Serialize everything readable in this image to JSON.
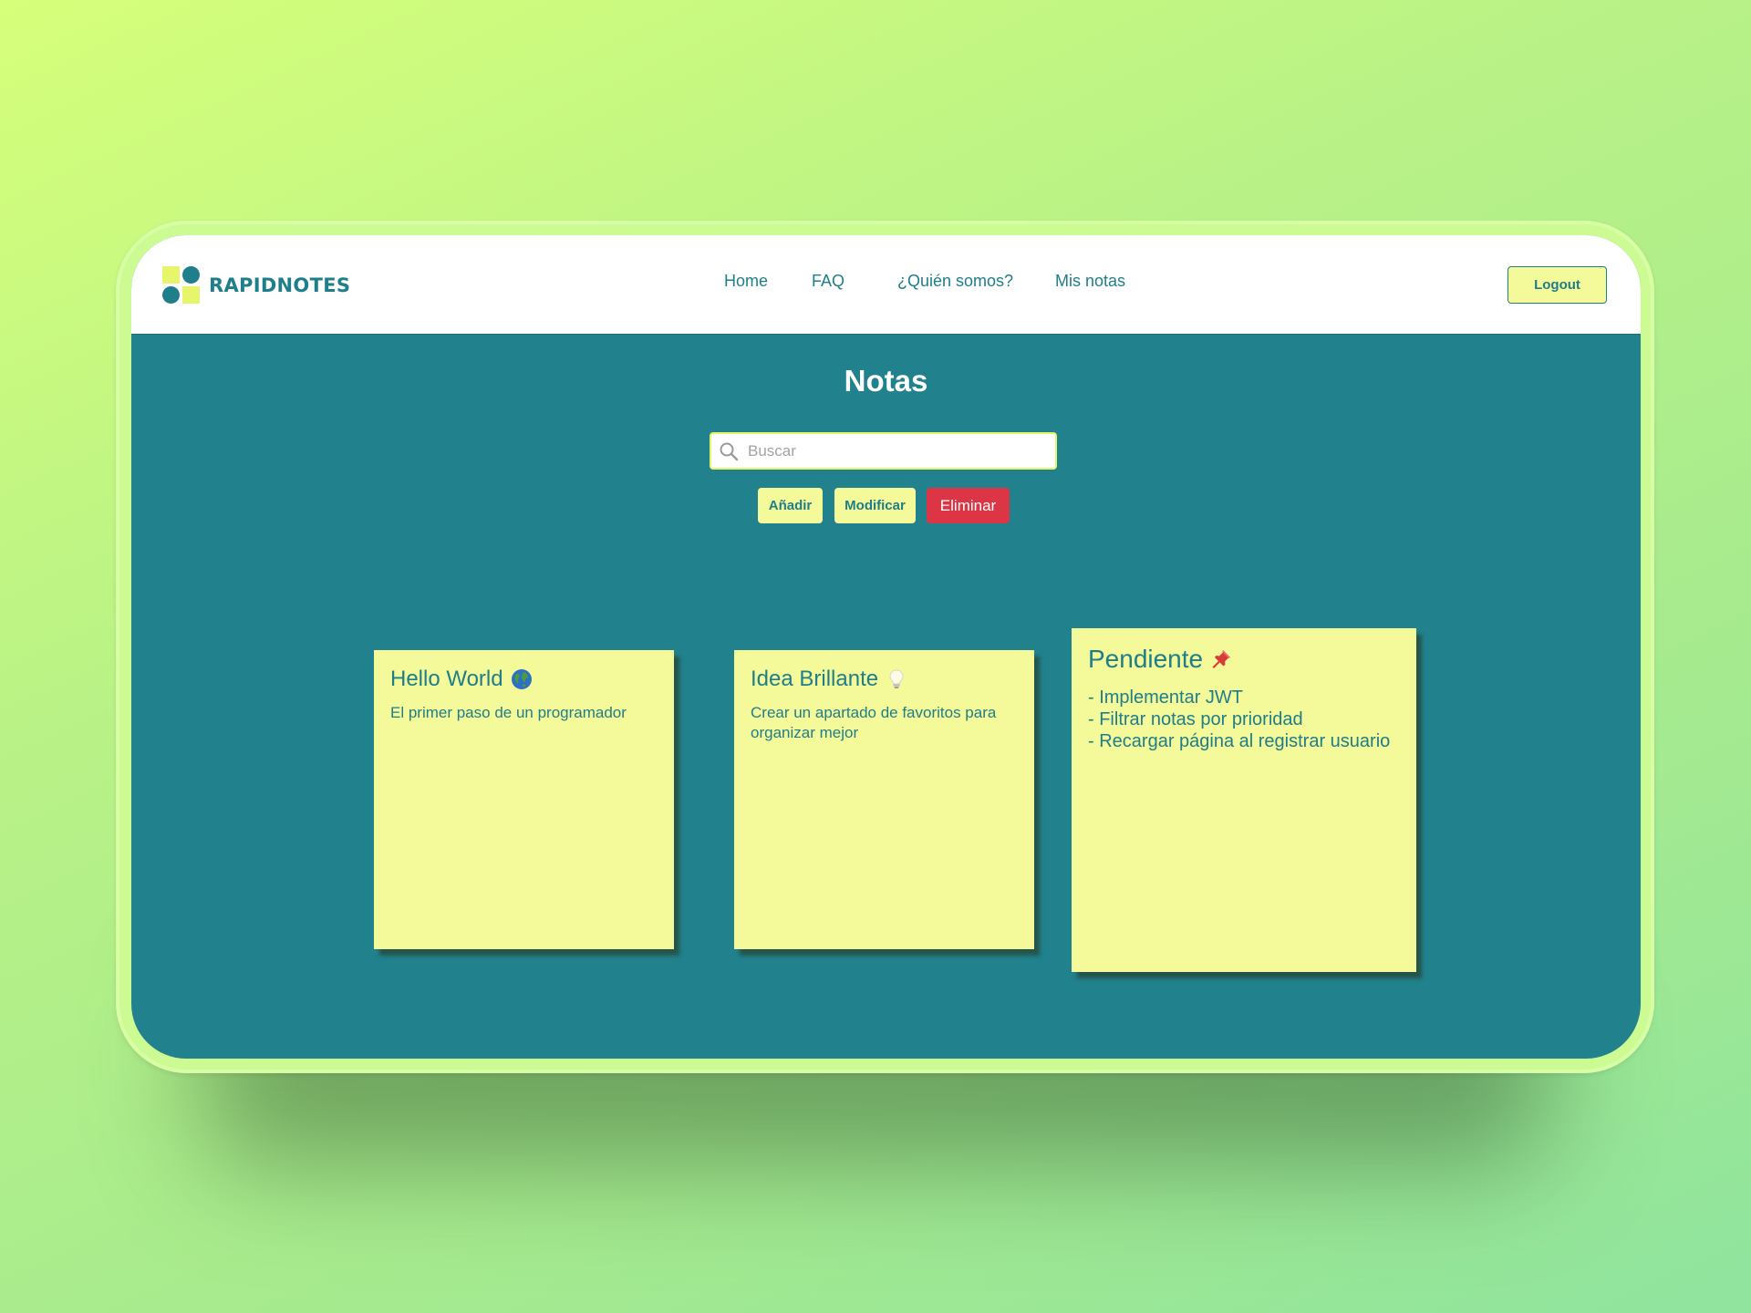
{
  "app": {
    "brand": "RAPIDNOTES",
    "colors": {
      "primary": "#1e7e89",
      "note": "#f4f99a",
      "accent": "#e6f56a",
      "danger": "#dc3545"
    }
  },
  "nav": {
    "links": [
      "Home",
      "FAQ",
      "¿Quién somos?",
      "Mis notas"
    ],
    "logout_label": "Logout"
  },
  "main": {
    "title": "Notas",
    "search": {
      "placeholder": "Buscar",
      "value": ""
    },
    "actions": {
      "add_label": "Añadir",
      "modify_label": "Modificar",
      "delete_label": "Eliminar"
    }
  },
  "notes": [
    {
      "title": "Hello World",
      "icon": "globe-icon",
      "body": "El primer paso de un programador"
    },
    {
      "title": "Idea Brillante",
      "icon": "lightbulb-icon",
      "body": "Crear un apartado de favoritos para organizar mejor"
    },
    {
      "title": "Pendiente",
      "icon": "pushpin-icon",
      "body": "- Implementar JWT\n- Filtrar notas por prioridad\n- Recargar página al registrar usuario"
    }
  ]
}
